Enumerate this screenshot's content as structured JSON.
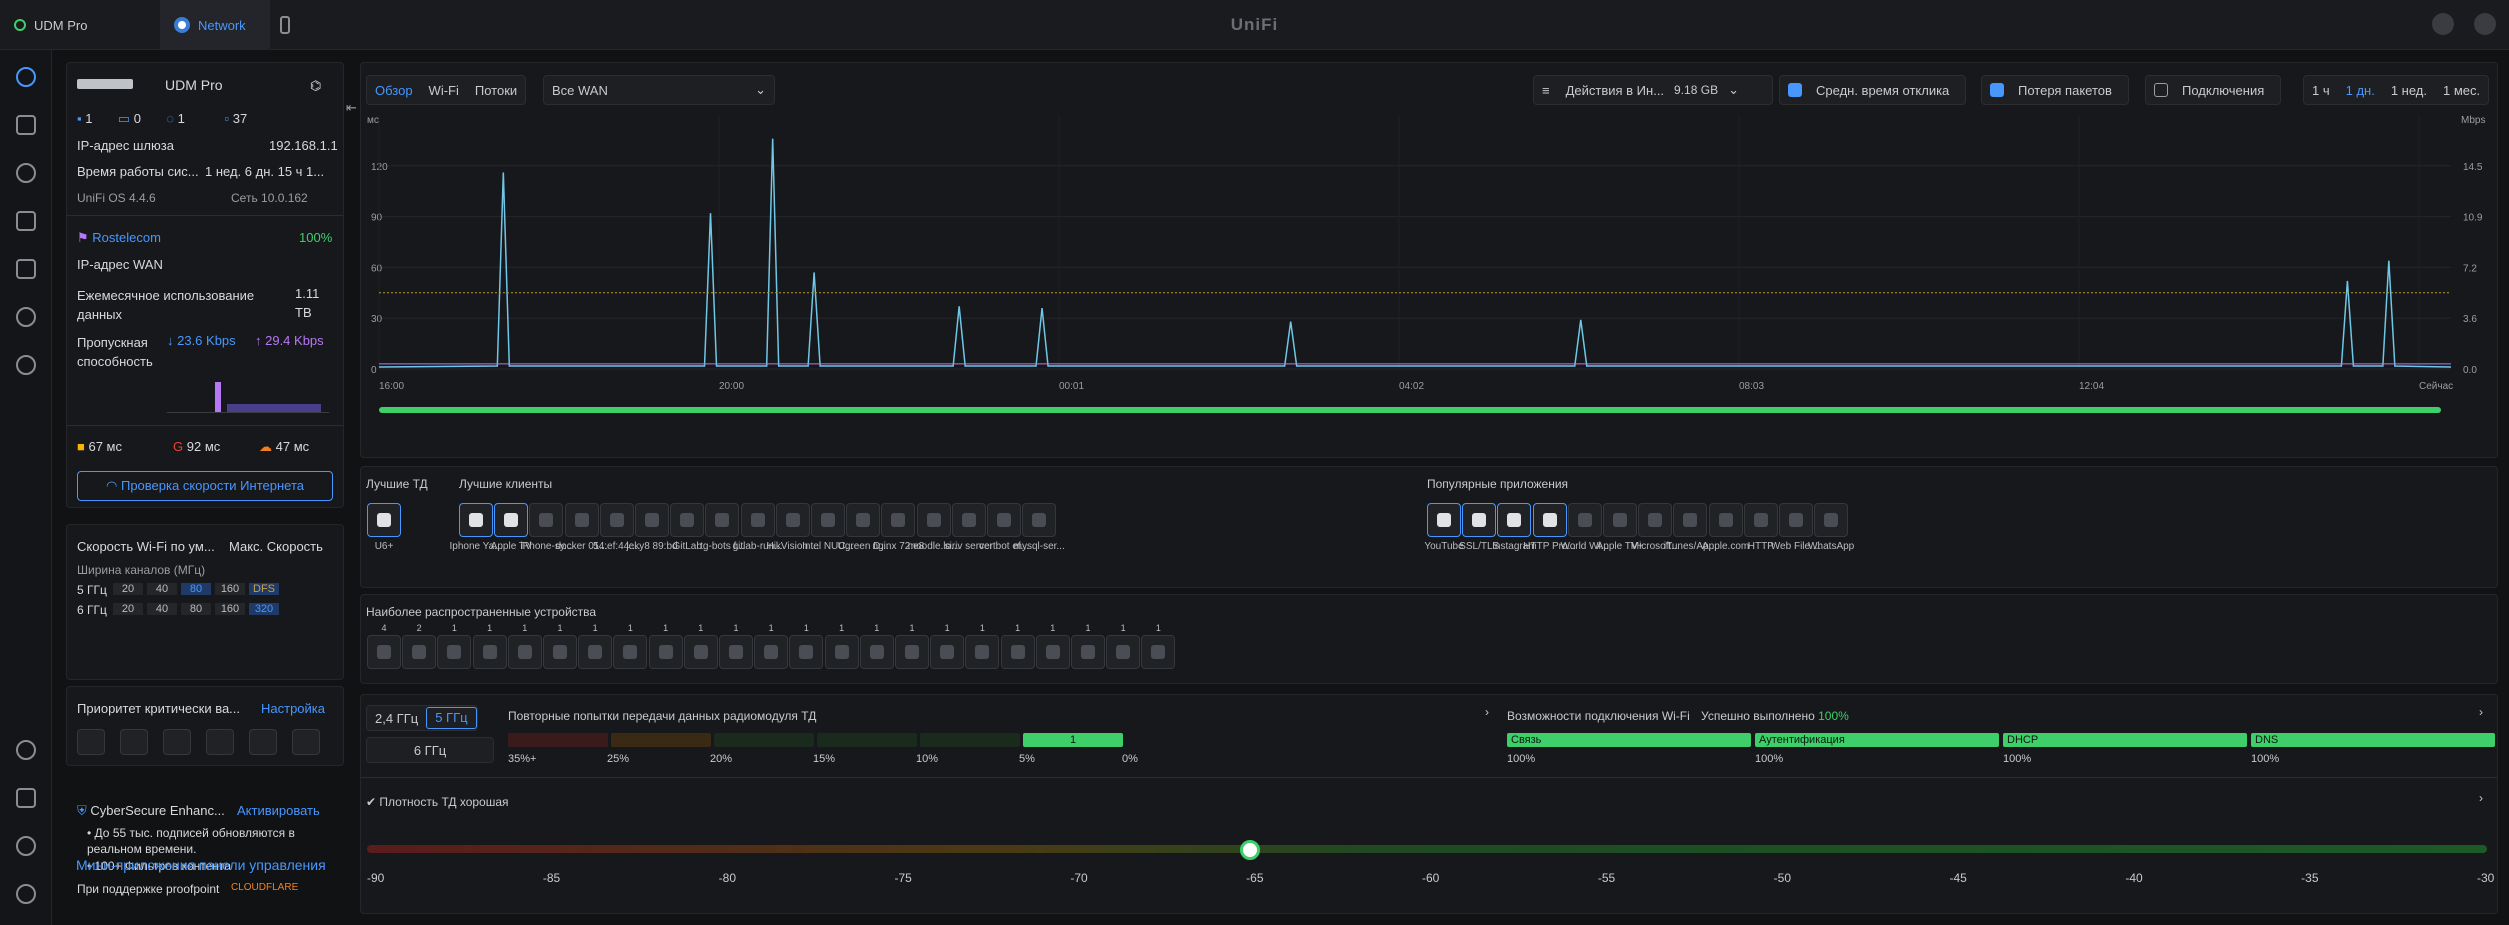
{
  "topbar": {
    "tabs": [
      {
        "label": "UDM Pro"
      },
      {
        "label": "Network"
      }
    ],
    "brand": "UniFi"
  },
  "device": {
    "name": "UDM Pro",
    "counts": [
      "1",
      "0",
      "1",
      "37"
    ],
    "gateway_ip_label": "IP-адрес шлюза",
    "gateway_ip": "192.168.1.1",
    "uptime_label": "Время работы сис...",
    "uptime": "1 нед. 6 дн. 15 ч 1...",
    "os": "UniFi OS 4.4.6",
    "network": "Сеть 10.0.162"
  },
  "isp": {
    "name": "Rostelecom",
    "health": "100%",
    "wan_ip_label": "IP-адрес WAN",
    "usage_label": "Ежемесячное использование данных",
    "usage_value": "1.11",
    "usage_unit": "TB",
    "bandwidth_label": "Пропускная способность",
    "down": "↓ 23.6 Kbps",
    "up": "↑ 29.4 Kbps",
    "latencies": [
      {
        "v": "67 мс"
      },
      {
        "v": "92 мс"
      },
      {
        "v": "47 мс"
      }
    ],
    "speedtest": "Проверка скорости Интернета"
  },
  "wifi_speed": {
    "title": "Скорость Wi-Fi по ум...",
    "max": "Макс. Скорость",
    "channel_label": "Ширина каналов (МГц)",
    "band5": "5 ГГц",
    "band6": "6 ГГц",
    "w5": [
      "20",
      "40",
      "80",
      "160",
      "DFS"
    ],
    "w6": [
      "20",
      "40",
      "80",
      "160",
      "320"
    ]
  },
  "priority": {
    "title": "Приоритет критически ва...",
    "setup": "Настройка"
  },
  "cyber": {
    "title": "CyberSecure Enhanc...",
    "activate": "Активировать",
    "b1": "До 55 тыс. подписей обновляются в реальном времени.",
    "b2": "100+ Фильтров контента",
    "support": "При поддержке proofpoint",
    "cf": "CLOUDFLARE"
  },
  "mini": "Мини-приложения панели управления",
  "toolbar": {
    "tabs": [
      "Обзор",
      "Wi-Fi",
      "Потоки"
    ],
    "wan": "Все WAN",
    "activity": "Действия в Ин...",
    "activity_val": "9.18 GB",
    "avg": "Средн. время отклика",
    "loss": "Потеря пакетов",
    "conn": "Подключения",
    "ranges": [
      "1 ч",
      "1 дн.",
      "1 нед.",
      "1 мес."
    ]
  },
  "chart_data": {
    "type": "line",
    "ylabel": "мс",
    "y2label": "Mbps",
    "y_ticks": [
      "0",
      "30",
      "60",
      "90",
      "120"
    ],
    "y2_ticks": [
      "0.0",
      "3.6",
      "7.2",
      "10.9",
      "14.5"
    ],
    "ylim": [
      0,
      150
    ],
    "x_ticks": [
      "16:00",
      "20:00",
      "00:01",
      "04:02",
      "08:03",
      "12:04",
      "Сейчас"
    ],
    "series": [
      {
        "color": "#6fc7e8",
        "peaks": [
          [
            0.06,
            116
          ],
          [
            0.16,
            92
          ],
          [
            0.19,
            136
          ],
          [
            0.21,
            57
          ],
          [
            0.28,
            37
          ],
          [
            0.32,
            36
          ],
          [
            0.44,
            28
          ],
          [
            0.58,
            29
          ],
          [
            0.95,
            52
          ],
          [
            0.97,
            64
          ]
        ]
      },
      {
        "color": "#b99a2f",
        "baseline": 45
      },
      {
        "color": "#b678f5",
        "baseline": 3
      }
    ]
  },
  "top": {
    "ap_label": "Лучшие ТД",
    "ap": "U6+",
    "clients_label": "Лучшие клиенты",
    "clients": [
      "Iphone Ya...",
      "Apple TV",
      "iPhone-sy...",
      "docker 01...",
      "54:ef:44:...",
      "jeky8 89:bd",
      "GitLab",
      "tg-bots f...",
      "gitlab-run...",
      "HikVision ...",
      "Intel NUC...",
      "Ugreen D...",
      "nginx 72:e8",
      "moodle.lo...",
      "siriv server",
      "certbot ef...",
      "mysql-ser..."
    ],
    "apps_label": "Популярные приложения",
    "apps": [
      "YouTube",
      "SSL/TLS",
      "Instagram",
      "HTTP Pro...",
      "World Wi...",
      "Apple TV+",
      "Microsoft...",
      "iTunes/Ap...",
      "Apple.com",
      "HTTP",
      "Web File ...",
      "WhatsApp"
    ]
  },
  "common": {
    "label": "Наиболее распространенные устройства",
    "counts": [
      "4",
      "2",
      "1",
      "1",
      "1",
      "1",
      "1",
      "1",
      "1",
      "1",
      "1",
      "1",
      "1",
      "1",
      "1",
      "1",
      "1",
      "1",
      "1",
      "1",
      "1",
      "1",
      "1"
    ]
  },
  "retry": {
    "b24": "2,4 ГГц",
    "b5": "5 ГГц",
    "b6": "6 ГГц",
    "title": "Повторные попытки передачи данных радиомодуля ТД",
    "steps": [
      "35%+",
      "25%",
      "20%",
      "15%",
      "10%",
      "5%",
      "0%"
    ],
    "active": "1"
  },
  "conn": {
    "title": "Возможности подключения Wi-Fi",
    "status": "Успешно выполнено",
    "pct": "100%",
    "stages": [
      {
        "n": "Связь",
        "v": "100%"
      },
      {
        "n": "Аутентификация",
        "v": "100%"
      },
      {
        "n": "DHCP",
        "v": "100%"
      },
      {
        "n": "DNS",
        "v": "100%"
      }
    ]
  },
  "density": {
    "title": "Плотность ТД хорошая",
    "value": -65,
    "ticks": [
      "-90",
      "-85",
      "-80",
      "-75",
      "-70",
      "-65",
      "-60",
      "-55",
      "-50",
      "-45",
      "-40",
      "-35",
      "-30"
    ]
  }
}
